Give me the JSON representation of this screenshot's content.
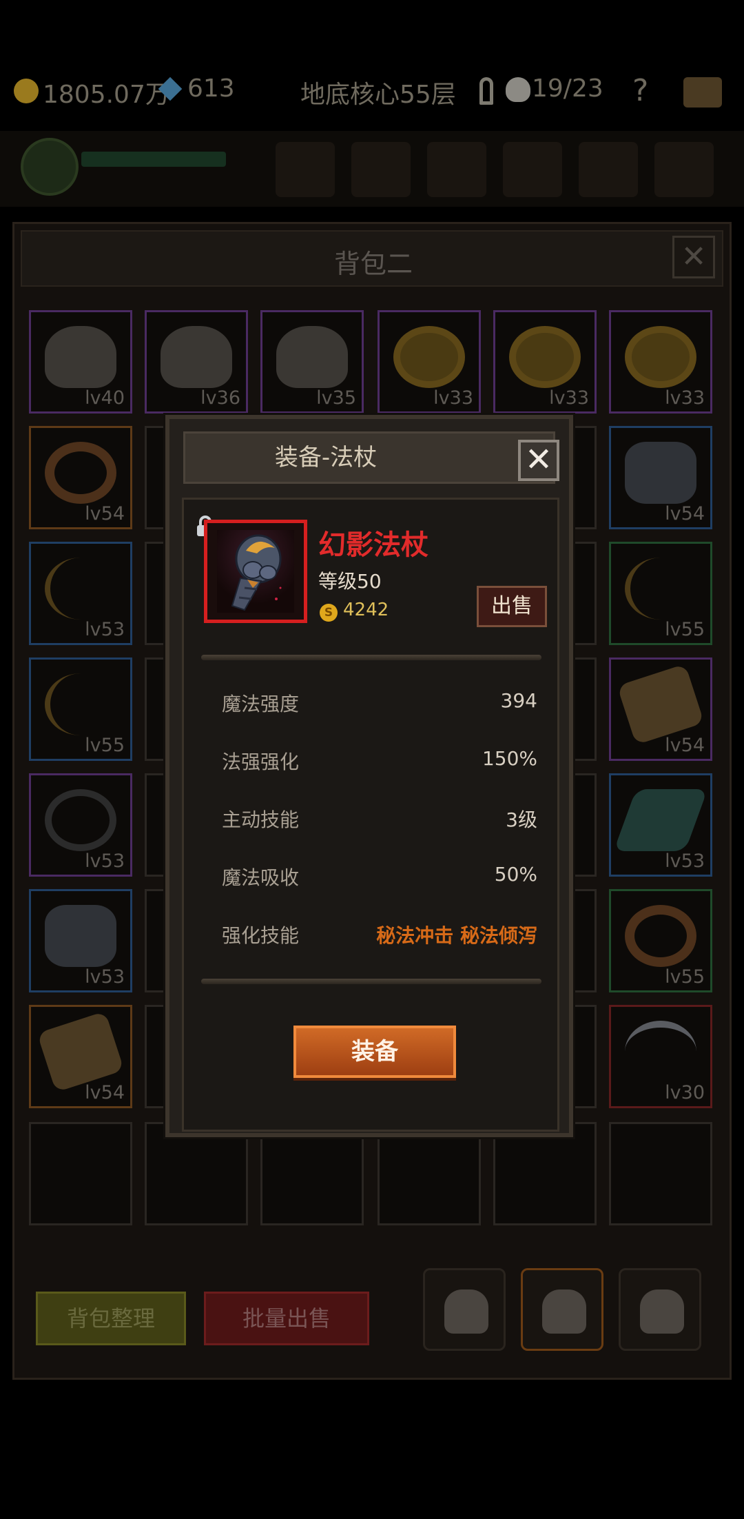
{
  "top_bar": {
    "gold": "1805.07万",
    "gems": "613",
    "floor": "地底核心55层",
    "skull_count": "19/23",
    "help": "?"
  },
  "bag": {
    "title": "背包二",
    "close_symbol": "✕",
    "slots": [
      {
        "icon": "skull",
        "lv": "lv40",
        "rarity": "purple"
      },
      {
        "icon": "skull",
        "lv": "lv36",
        "rarity": "purple"
      },
      {
        "icon": "skull",
        "lv": "lv35",
        "rarity": "purple"
      },
      {
        "icon": "ring",
        "lv": "lv33",
        "rarity": "purple"
      },
      {
        "icon": "ring",
        "lv": "lv33",
        "rarity": "purple"
      },
      {
        "icon": "ring",
        "lv": "lv33",
        "rarity": "purple"
      },
      {
        "icon": "horn",
        "lv": "lv54",
        "rarity": "orange"
      },
      {
        "icon": "armor",
        "lv": "lv54",
        "rarity": "blue"
      },
      {
        "icon": "bow",
        "lv": "lv53",
        "rarity": "blue"
      },
      {
        "icon": "bow",
        "lv": "lv55",
        "rarity": "green"
      },
      {
        "icon": "bow",
        "lv": "lv55",
        "rarity": "blue"
      },
      {
        "icon": "bracer",
        "lv": "lv54",
        "rarity": "purple"
      },
      {
        "icon": "blackring",
        "lv": "lv53",
        "rarity": "purple"
      },
      {
        "icon": "dagger",
        "lv": "lv53",
        "rarity": "blue"
      },
      {
        "icon": "armor",
        "lv": "lv53",
        "rarity": "blue"
      },
      {
        "icon": "horn",
        "lv": "lv55",
        "rarity": "green"
      },
      {
        "icon": "bracer",
        "lv": "lv54",
        "rarity": "orange"
      },
      {
        "icon": "scythe",
        "lv": "lv30",
        "rarity": "red"
      }
    ],
    "sort_label": "背包整理",
    "bulk_sell_label": "批量出售"
  },
  "modal": {
    "title": "装备-法杖",
    "close_symbol": "✕",
    "item_name": "幻影法杖",
    "item_level": "等级50",
    "price": "4242",
    "coin_symbol": "S",
    "sell_label": "出售",
    "stats": [
      {
        "label": "魔法强度",
        "value": "394"
      },
      {
        "label": "法强强化",
        "value": "150%"
      },
      {
        "label": "主动技能",
        "value": "3级"
      },
      {
        "label": "魔法吸收",
        "value": "50%"
      },
      {
        "label": "强化技能",
        "value": "秘法冲击 秘法倾泻"
      }
    ],
    "equip_label": "装备"
  },
  "colors": {
    "item_name": "#e22b2b",
    "highlight": "#d76a18",
    "equip_button": "#c75c20"
  }
}
